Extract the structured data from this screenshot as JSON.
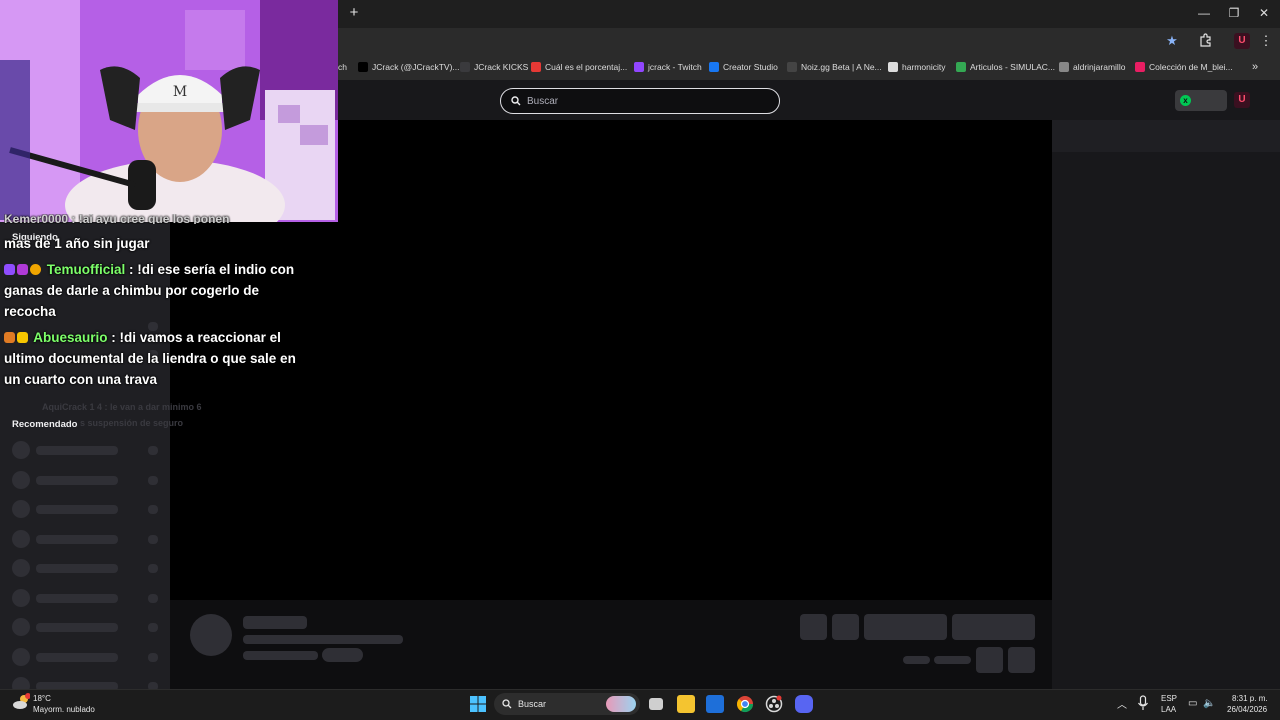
{
  "browser": {
    "bookmarks": [
      {
        "label": "ch",
        "icon": "bookmark-icon",
        "color": "#2b2b2b"
      },
      {
        "label": "JCrack (@JCrackTV)...",
        "icon": "x-icon",
        "color": "#000000"
      },
      {
        "label": "JCrack KICKS",
        "icon": "twitch-icon",
        "color": "#3a3a3d"
      },
      {
        "label": "Cuál es el porcentaj...",
        "icon": "s-icon",
        "color": "#e53935"
      },
      {
        "label": "jcrack - Twitch",
        "icon": "twitch-icon",
        "color": "#9146ff"
      },
      {
        "label": "Creator Studio",
        "icon": "facebook-icon",
        "color": "#1877f2"
      },
      {
        "label": "Noiz.gg Beta | A Ne...",
        "icon": "noiz-icon",
        "color": "#444444"
      },
      {
        "label": "harmonicity",
        "icon": "page-icon",
        "color": "#dddddd"
      },
      {
        "label": "Articulos - SIMULAC...",
        "icon": "drive-icon",
        "color": "#34a853"
      },
      {
        "label": "aldrinjaramillo",
        "icon": "profile-icon",
        "color": "#888888"
      },
      {
        "label": "Colección de M_blei...",
        "icon": "collection-icon",
        "color": "#e91e63"
      }
    ],
    "more_bookmarks": "»",
    "new_tab": "+",
    "window_controls": {
      "minimize": "—",
      "restore": "❐",
      "close": "✕"
    }
  },
  "twitch": {
    "search_placeholder": "Buscar",
    "sidebar": {
      "following_heading": "Siguiendo",
      "recommended_heading": "Recomendado"
    }
  },
  "chat": {
    "partial_first": "mas de 1 año sin jugar",
    "partial_user": "Kemer0000 : !ai ayu cree que los ponen",
    "messages": [
      {
        "user": "Temuofficial",
        "text": " : !di ese sería el indio con ganas de darle a chimbu por cogerlo de recocha"
      },
      {
        "user": "Abuesaurio",
        "text": " : !di vamos a reaccionar el ultimo documental de la liendra o que sale en un cuarto con una trava"
      }
    ],
    "faded_line_1": "AquiCrack 1 4 : le van a dar minimo 6",
    "faded_line_2": "s suspensión de seguro"
  },
  "taskbar": {
    "weather_temp": "18°C",
    "weather_desc": "Mayorm. nublado",
    "search_label": "Buscar",
    "lang_1": "ESP",
    "lang_2": "LAA",
    "time": "8:31 p. m.",
    "date": "26/04/2026"
  }
}
